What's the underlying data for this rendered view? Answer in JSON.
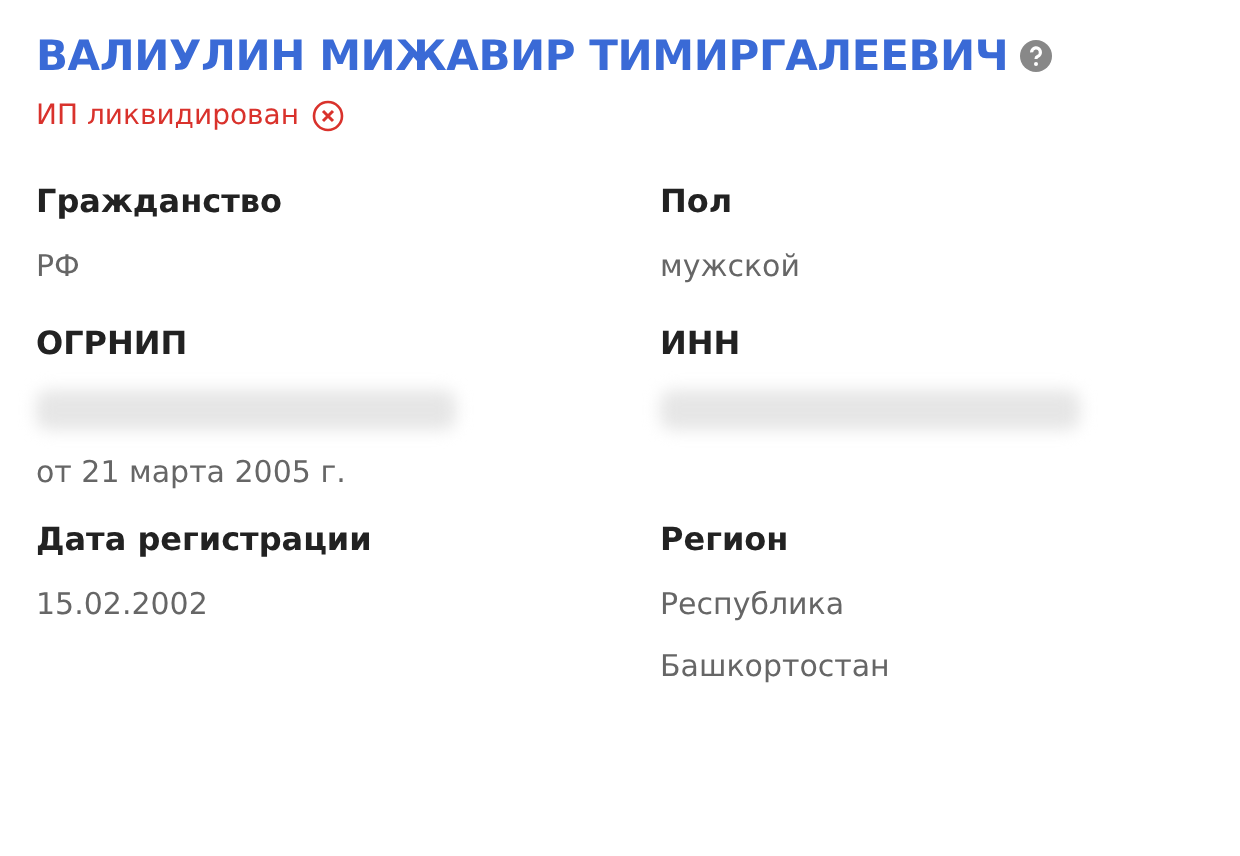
{
  "person": {
    "name": "ВАЛИУЛИН МИЖАВИР ТИМИРГАЛЕЕВИЧ",
    "status": "ИП ликвидирован"
  },
  "fields": [
    {
      "label": "Гражданство",
      "value": "РФ",
      "redacted": false
    },
    {
      "label": "Пол",
      "value": "мужской",
      "redacted": false
    },
    {
      "label": "ОГРНИП",
      "redacted": true,
      "note": "от 21 марта 2005 г."
    },
    {
      "label": "ИНН",
      "redacted": true
    },
    {
      "label": "Дата регистрации",
      "value": "15.02.2002",
      "redacted": false
    },
    {
      "label": "Регион",
      "value": "Республика Башкортостан",
      "redacted": false
    }
  ]
}
